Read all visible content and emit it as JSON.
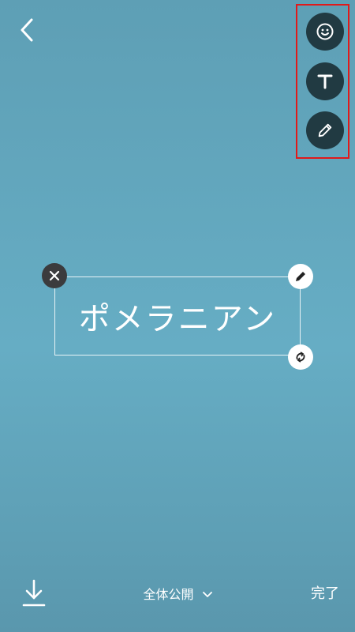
{
  "header": {
    "back_icon": "chevron-left-icon"
  },
  "tools": {
    "items": [
      {
        "id": "sticker",
        "icon": "smiley-icon"
      },
      {
        "id": "text",
        "icon": "text-t-icon"
      },
      {
        "id": "pen",
        "icon": "pencil-icon"
      }
    ],
    "highlight_color": "#e01a1a"
  },
  "canvas": {
    "text": "ポメラニアン",
    "background_color": "#66adc4"
  },
  "text_box": {
    "delete_icon": "close-icon",
    "edit_icon": "pencil-icon",
    "rotate_icon": "rotate-icon"
  },
  "bottom_bar": {
    "download_icon": "download-icon",
    "privacy_label": "全体公開",
    "privacy_icon": "chevron-down-icon",
    "done_label": "完了"
  }
}
